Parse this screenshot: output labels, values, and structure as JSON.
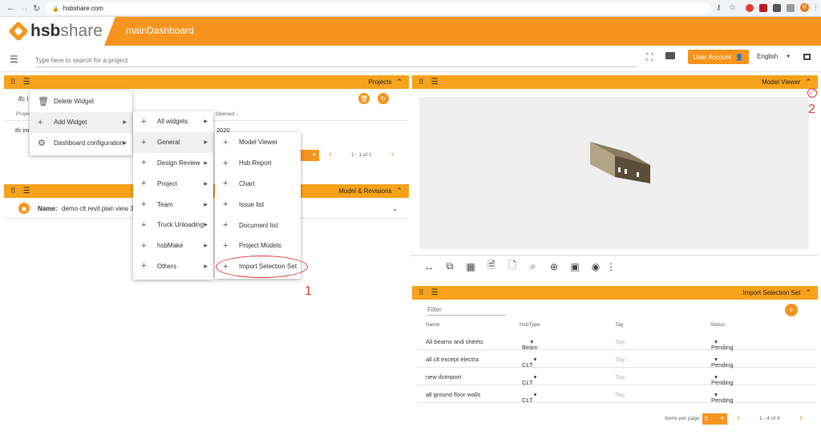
{
  "browser": {
    "url": "hsbshare.com",
    "profile_initial": "R"
  },
  "app": {
    "logo_bold": "hsb",
    "logo_light": "share",
    "dashboard_title": "mainDashboard"
  },
  "search": {
    "placeholder": "Type here to search for a project"
  },
  "header": {
    "user_account": "User Account",
    "language": "English"
  },
  "projects_widget": {
    "title": "Projects",
    "filter_value": "ifc i",
    "col_project": "Projec",
    "col_opened": "Opened",
    "row_name": "ifc im",
    "row_opened": "2020",
    "pagination": "1 - 1 of 1"
  },
  "model_revisions_widget": {
    "title": "Model & Revisions",
    "name_label": "Name:",
    "name_value": "demo clt revit plan view 3"
  },
  "context_menu": {
    "items": [
      {
        "label": "Delete Widget",
        "icon": "trash-icon"
      },
      {
        "label": "Add Widget",
        "icon": "plus-icon"
      },
      {
        "label": "Dashboard configuration",
        "icon": "gear-icon"
      }
    ]
  },
  "add_widget_menu": {
    "items": [
      "All widgets",
      "General",
      "Design Review",
      "Project",
      "Team",
      "Truck Unloading",
      "hsbMake",
      "Others"
    ]
  },
  "general_menu": {
    "items": [
      "Model Viewer",
      "Hsb Report",
      "Chart",
      "Issue list",
      "Document list",
      "Project Models",
      "Import Selection Set"
    ]
  },
  "annotations": {
    "label1": "1",
    "label2": "2"
  },
  "model_viewer_widget": {
    "title": "Model Viewer"
  },
  "import_widget": {
    "title": "Import Selection Set",
    "filter_placeholder": "Filter",
    "headers": [
      "Name",
      "HsbType",
      "Tag",
      "Status"
    ],
    "rows": [
      {
        "name": "All beams and sheets",
        "type": "Beam",
        "tag": "Tag",
        "status": "Pending"
      },
      {
        "name": "all clt except electra",
        "type": "CLT",
        "tag": "Tag",
        "status": "Pending"
      },
      {
        "name": "new ifcimport",
        "type": "CLT",
        "tag": "Tag",
        "status": "Pending"
      },
      {
        "name": "all ground floor walls",
        "type": "CLT",
        "tag": "Tag",
        "status": "Pending"
      }
    ],
    "items_per_page_label": "Items per page",
    "items_per_page_value": "5",
    "pagination": "1 - 4 of 4"
  },
  "colors": {
    "brand_orange": "#f7941d",
    "widget_header": "#f7a21b",
    "annotation_red": "#e53935"
  }
}
